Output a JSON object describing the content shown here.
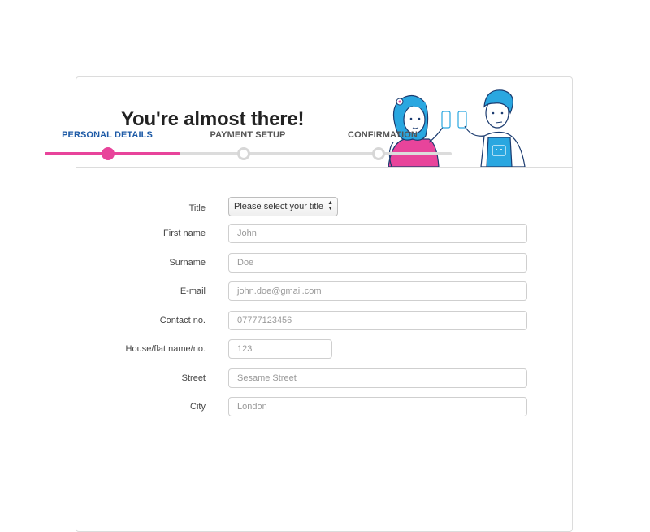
{
  "header": {
    "title": "You're almost there!"
  },
  "steps": [
    {
      "label": "PERSONAL DETAILS",
      "state": "active"
    },
    {
      "label": "PAYMENT SETUP",
      "state": "pending"
    },
    {
      "label": "CONFIRMATION",
      "state": "pending"
    }
  ],
  "progress": {
    "fraction": 0.333
  },
  "colors": {
    "accent_pink": "#e8449b",
    "active_step_blue": "#1d5aa6",
    "illustration_blue": "#2aa7e0"
  },
  "form": {
    "title": {
      "label": "Title",
      "value": "Please select your title"
    },
    "first_name": {
      "label": "First name",
      "placeholder": "John"
    },
    "surname": {
      "label": "Surname",
      "placeholder": "Doe"
    },
    "email": {
      "label": "E-mail",
      "placeholder": "john.doe@gmail.com"
    },
    "contact": {
      "label": "Contact no.",
      "placeholder": "07777123456"
    },
    "house": {
      "label": "House/flat name/no.",
      "placeholder": "123"
    },
    "street": {
      "label": "Street",
      "placeholder": "Sesame Street"
    },
    "city": {
      "label": "City",
      "placeholder": "London"
    }
  },
  "icons": {
    "select_arrows": "updown-chevron-icon",
    "illustration": "two-people-phones-illustration"
  }
}
